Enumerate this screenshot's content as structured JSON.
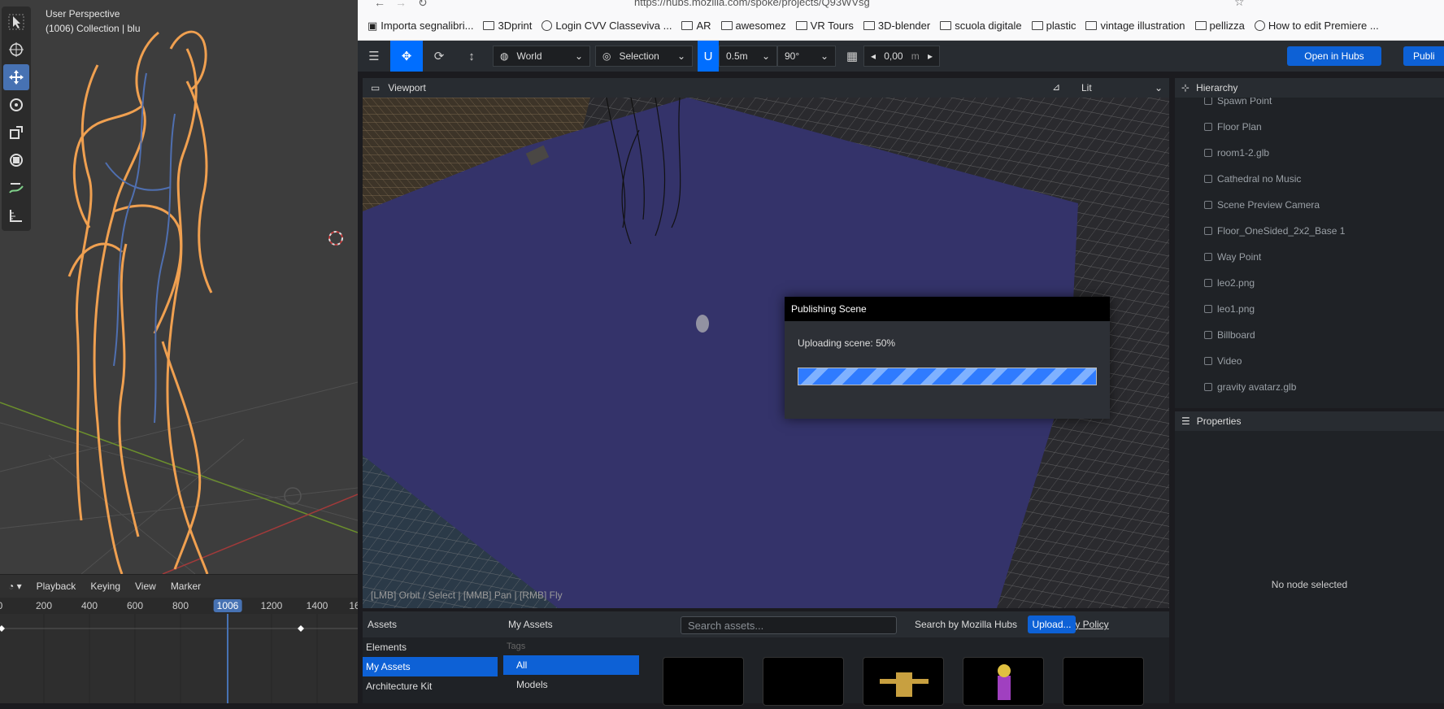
{
  "blender": {
    "view_name": "User Perspective",
    "collection": "(1006) Collection | blu",
    "timeline": {
      "menus": [
        "Playback",
        "Keying",
        "View",
        "Marker"
      ],
      "ticks": [
        "0",
        "200",
        "400",
        "600",
        "800",
        "1200",
        "1400",
        "16"
      ],
      "current_frame": "1006"
    }
  },
  "browser": {
    "url": "https://hubs.mozilla.com/spoke/projects/Q93WVsg",
    "bookmarks": [
      "Importa segnalibri...",
      "3Dprint",
      "Login CVV Classeviva ...",
      "AR",
      "awesomez",
      "VR Tours",
      "3D-blender",
      "scuola digitale",
      "plastic",
      "vintage illustration",
      "pellizza",
      "How to edit Premiere ..."
    ]
  },
  "spoke": {
    "toolbar": {
      "transform_space": "World",
      "pivot": "Selection",
      "snap_translate": "0.5m",
      "snap_rotate": "90°",
      "grid_value": "0,00",
      "grid_unit": "m",
      "open_hubs": "Open in Hubs",
      "publish": "Publi"
    },
    "viewport": {
      "title": "Viewport",
      "render_mode": "Lit",
      "hint": "[LMB] Orbit / Select | [MMB] Pan | [RMB] Fly"
    },
    "dialog": {
      "title": "Publishing Scene",
      "message": "Uploading scene: 50%",
      "progress": 0.5
    },
    "hierarchy": {
      "title": "Hierarchy",
      "items": [
        "Spawn Point",
        "Floor Plan",
        "room1-2.glb",
        "Cathedral no Music",
        "Scene Preview Camera",
        "Floor_OneSided_2x2_Base 1",
        "Way Point",
        "leo2.png",
        "leo1.png",
        "Billboard",
        "Video",
        "gravity avatarz.glb"
      ]
    },
    "properties": {
      "title": "Properties",
      "empty": "No node selected"
    },
    "assets": {
      "title": "Assets",
      "section": "My Assets",
      "search_placeholder": "Search assets...",
      "search_by": "Search by Mozilla Hubs",
      "separator": "|",
      "privacy": "Privacy Policy",
      "upload": "Upload...",
      "sources": [
        "Elements",
        "My Assets",
        "Architecture Kit"
      ],
      "tags_label": "Tags",
      "tags": [
        "All",
        "Models"
      ]
    }
  }
}
